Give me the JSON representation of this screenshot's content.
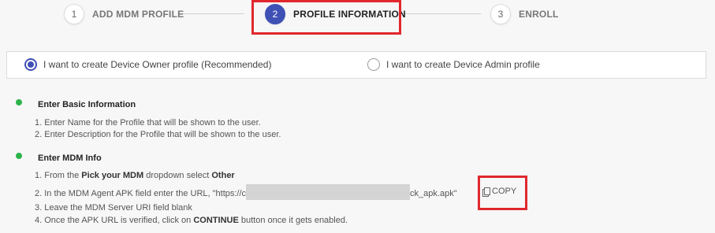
{
  "stepper": {
    "steps": [
      {
        "number": "1",
        "label": "ADD MDM PROFILE"
      },
      {
        "number": "2",
        "label": "PROFILE INFORMATION"
      },
      {
        "number": "3",
        "label": "ENROLL"
      }
    ],
    "active_step": 2
  },
  "profile_type": {
    "options": [
      {
        "label": "I want to create Device Owner profile (Recommended)",
        "selected": true
      },
      {
        "label": "I want to create Device Admin profile",
        "selected": false
      }
    ]
  },
  "basic_info": {
    "title": "Enter Basic Information",
    "items": [
      "1. Enter Name for the Profile that will be shown to the user.",
      "2. Enter Description for the Profile that will be shown to the user."
    ]
  },
  "mdm_info": {
    "title": "Enter MDM Info",
    "item1": {
      "prefix": "1. From the ",
      "bold1": "Pick your MDM",
      "middle": " dropdown select ",
      "bold2": "Other"
    },
    "item2": {
      "prefix": "2. In the MDM Agent APK field enter the URL, \"https://c",
      "suffix": "ck_apk.apk\""
    },
    "copy_label": "COPY",
    "item3": "3. Leave the MDM Server URI field blank",
    "item4": {
      "prefix": "4. Once the APK URL is verified, click on ",
      "bold": "CONTINUE",
      "suffix": " button once it gets enabled."
    }
  },
  "colors": {
    "accent": "#3f51b5",
    "success": "#2eb34a",
    "highlight": "#e0282e"
  }
}
